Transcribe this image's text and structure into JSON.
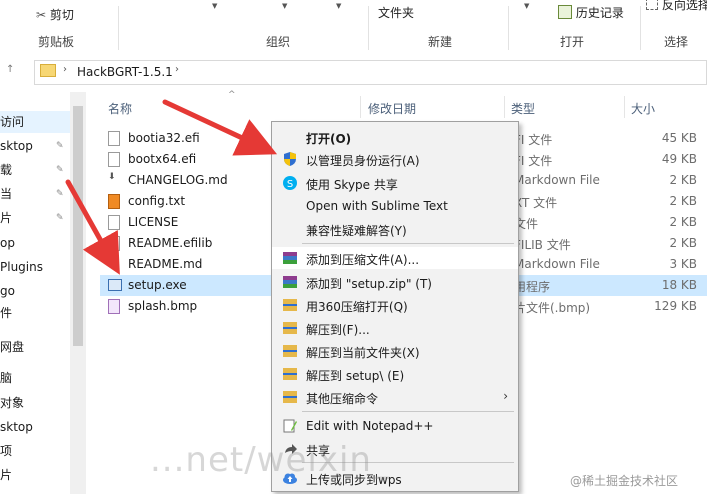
{
  "ribbon": {
    "cut": "剪切",
    "file_clip": "文件夹",
    "history": "历史记录",
    "reverse_select": "反向选择",
    "groups": {
      "clipboard": "剪贴板",
      "organize": "组织",
      "new": "新建",
      "open": "打开",
      "select": "选择"
    }
  },
  "address": {
    "path": "HackBGRT-1.5.1"
  },
  "nav": {
    "items": [
      "访问",
      "sktop",
      "载",
      "当",
      "片",
      "op",
      "Plugins",
      "go",
      "件",
      "网盘",
      "脑",
      "对象",
      "sktop",
      "项",
      "片"
    ]
  },
  "columns": {
    "name": "名称",
    "modified": "修改日期",
    "type": "类型",
    "size": "大小"
  },
  "files": [
    {
      "name": "bootia32.efi",
      "type": "FI 文件",
      "size": "45 KB",
      "icon": "file-icon"
    },
    {
      "name": "bootx64.efi",
      "type": "FI 文件",
      "size": "49 KB",
      "icon": "file-icon"
    },
    {
      "name": "CHANGELOG.md",
      "type": "Markdown File",
      "size": "2 KB",
      "icon": "markdown-file-icon"
    },
    {
      "name": "config.txt",
      "type": "XT 文件",
      "size": "2 KB",
      "icon": "sublime-file-icon"
    },
    {
      "name": "LICENSE",
      "type": "文件",
      "size": "2 KB",
      "icon": "file-icon"
    },
    {
      "name": "README.efilib",
      "type": "FILIB 文件",
      "size": "2 KB",
      "icon": "file-icon"
    },
    {
      "name": "README.md",
      "type": "Markdown File",
      "size": "3 KB",
      "icon": "markdown-file-icon"
    },
    {
      "name": "setup.exe",
      "type": "用程序",
      "size": "18 KB",
      "icon": "exe-icon"
    },
    {
      "name": "splash.bmp",
      "type": "片文件(.bmp)",
      "size": "129 KB",
      "icon": "bitmap-icon"
    }
  ],
  "menu": {
    "open": "打开(O)",
    "run_as_admin": "以管理员身份运行(A)",
    "skype_share": "使用 Skype 共享",
    "open_sublime": "Open with Sublime Text",
    "compat": "兼容性疑难解答(Y)",
    "add_archive": "添加到压缩文件(A)...",
    "add_zip": "添加到 \"setup.zip\" (T)",
    "open_360": "用360压缩打开(Q)",
    "extract_to": "解压到(F)...",
    "extract_here": "解压到当前文件夹(X)",
    "extract_setup": "解压到 setup\\ (E)",
    "other_compress": "其他压缩命令",
    "notepadpp": "Edit with Notepad++",
    "share": "共享",
    "wps": "上传或同步到wps"
  },
  "watermark": {
    "text": "...net/weixin_",
    "juejin": "@稀土掘金技术社区"
  },
  "colors": {
    "selection": "#cce8ff",
    "arrow": "#e53935",
    "menu_bg": "#f2f2f2"
  }
}
